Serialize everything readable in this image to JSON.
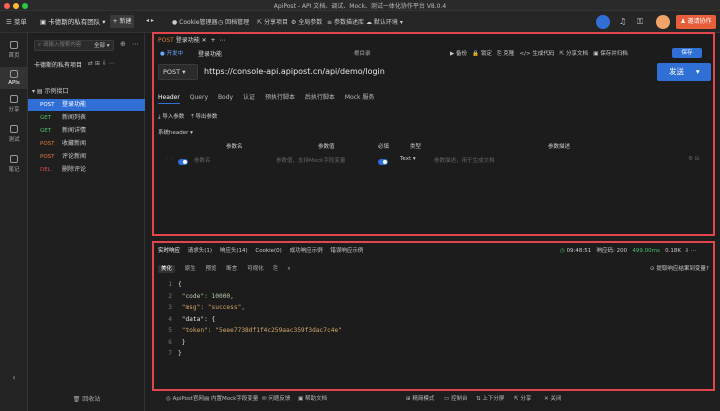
{
  "window": {
    "title": "ApiPost - API 文档、调试、Mock、测试一体化协作平台 V8.0.4"
  },
  "topbar": {
    "menu_label": "菜单",
    "team_name": "卡德斯的私有团队",
    "new_label": "+ 新建",
    "nav": [
      "Cookie管理器",
      "回档管理",
      "分享项目",
      "全局参数",
      "参数描述库",
      "默认环境"
    ],
    "invite_label": "邀请协作"
  },
  "rail": [
    {
      "label": "首页"
    },
    {
      "label": "APIs"
    },
    {
      "label": "分享"
    },
    {
      "label": "测试"
    },
    {
      "label": "笔记"
    }
  ],
  "sidebar": {
    "search_placeholder": "请输入搜索内容",
    "filter_label": "全部",
    "project_name": "卡德斯的私有项目",
    "folder": "示例接口",
    "items": [
      {
        "method": "POST",
        "name": "登录功能",
        "selected": true
      },
      {
        "method": "GET",
        "name": "新闻列表",
        "selected": false
      },
      {
        "method": "GET",
        "name": "新闻详情",
        "selected": false
      },
      {
        "method": "POST",
        "name": "收藏新闻",
        "selected": false
      },
      {
        "method": "POST",
        "name": "评论新闻",
        "selected": false
      },
      {
        "method": "DEL",
        "name": "删除评论",
        "selected": false
      }
    ],
    "recycle_label": "回收站"
  },
  "request": {
    "tab": {
      "method": "POST",
      "name": "登录功能"
    },
    "status": "● 开发中",
    "doc_name": "登录功能",
    "dir": "根目录",
    "actions": [
      "备份",
      "锁定",
      "克隆",
      "生成代码",
      "分享文档",
      "保存并归档"
    ],
    "save_label": "保存",
    "method": "POST",
    "url": "https://console-api.apipost.cn/api/demo/login",
    "send_label": "发送",
    "tabs": [
      "Header",
      "Query",
      "Body",
      "认证",
      "预执行脚本",
      "后执行脚本",
      "Mock 服务"
    ],
    "active_tab": "Header",
    "tools": [
      "导入参数",
      "导出参数"
    ],
    "sys_header": "系统header",
    "columns": [
      "参数名",
      "参数值",
      "必填",
      "类型",
      "参数描述"
    ],
    "row": {
      "name_ph": "参数名",
      "value_ph": "参数值，支持Mock字段变量",
      "type": "Text",
      "desc_ph": "参数描述，用于生成文档"
    }
  },
  "response": {
    "tabs": [
      "实时响应",
      "请求头(1)",
      "响应头(14)",
      "Cookie(0)",
      "成功响应示例",
      "错误响应示例"
    ],
    "time": "09:48:51",
    "status": "响应码: 200",
    "duration": "499.00ms",
    "size": "0.18K",
    "view_tabs": [
      "美化",
      "原生",
      "预览",
      "断言",
      "可视化"
    ],
    "assert_label": "提取响应结果到变量?",
    "lines": [
      {
        "no": "1",
        "text": "{"
      },
      {
        "no": "2",
        "text": "    \"code\": 10000,"
      },
      {
        "no": "3",
        "text": "    \"msg\": \"success\","
      },
      {
        "no": "4",
        "text": "    \"data\": {"
      },
      {
        "no": "5",
        "text": "        \"token\": \"5eee7738df1f4c259aac359f3dac7c4e\""
      },
      {
        "no": "6",
        "text": "    }"
      },
      {
        "no": "7",
        "text": "}"
      }
    ]
  },
  "statusbar": {
    "left": [
      "ApiPost官网",
      "内置Mock字段变量",
      "问题反馈",
      "帮助文档"
    ],
    "right": [
      "精简模式",
      "控制台",
      "上下分屏",
      "分享",
      "关闭"
    ]
  },
  "colors": {
    "accent": "#2f6fd6",
    "highlight": "#e0464b",
    "post": "#e07a3a",
    "get": "#4cc36a"
  }
}
